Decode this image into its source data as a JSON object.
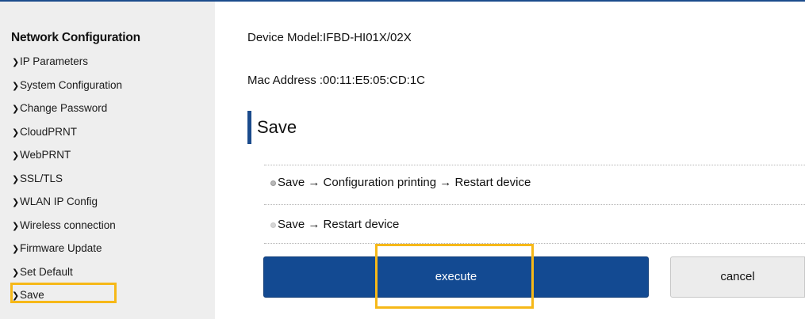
{
  "sidebar": {
    "title": "Network Configuration",
    "items": [
      {
        "label": "IP Parameters"
      },
      {
        "label": "System Configuration"
      },
      {
        "label": "Change Password"
      },
      {
        "label": "CloudPRNT"
      },
      {
        "label": "WebPRNT"
      },
      {
        "label": "SSL/TLS"
      },
      {
        "label": "WLAN IP Config"
      },
      {
        "label": "Wireless connection"
      },
      {
        "label": "Firmware Update"
      },
      {
        "label": "Set Default"
      },
      {
        "label": "Save"
      }
    ],
    "chevron_icon": "chevron-right-icon",
    "highlight_color": "#f6b818"
  },
  "device": {
    "model_line": "Device Model:IFBD-HI01X/02X",
    "mac_line": "Mac Address :00:11:E5:05:CD:1C"
  },
  "section": {
    "title": "Save",
    "accent_color": "#1b4b8c"
  },
  "options": [
    {
      "label": "Save → Configuration printing → Restart device",
      "selected": true
    },
    {
      "label": "Save → Restart device",
      "selected": false
    }
  ],
  "buttons": {
    "execute": "execute",
    "cancel": "cancel",
    "execute_color": "#134a92"
  }
}
